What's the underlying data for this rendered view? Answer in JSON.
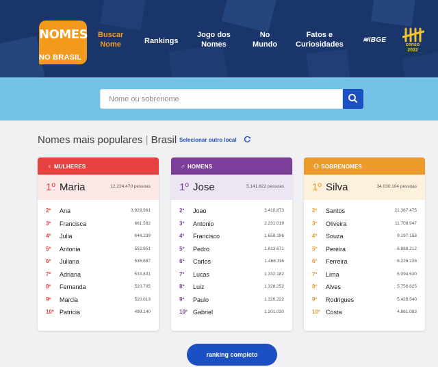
{
  "header": {
    "logo": {
      "top": "NOMES",
      "bottom": "NO BRASIL"
    },
    "nav": [
      {
        "label": "Buscar\nNome",
        "active": true
      },
      {
        "label": "Rankings",
        "active": false
      },
      {
        "label": "Jogo dos\nNomes",
        "active": false
      },
      {
        "label": "No\nMundo",
        "active": false
      },
      {
        "label": "Fatos e\nCuriosidades",
        "active": false
      }
    ],
    "ibge": "≋IBGE",
    "censo": "censo\n2022"
  },
  "search": {
    "placeholder": "Nome ou sobrenome",
    "value": ""
  },
  "main": {
    "heading_prefix": "Nomes mais populares",
    "heading_separator": "|",
    "heading_location": "Brasil",
    "select_location": "Selecionar outro local",
    "cta": "ranking completo"
  },
  "cards": [
    {
      "title": "MULHERES",
      "icon": "female-icon",
      "glyph": "♀",
      "head_color": "#e5423f",
      "top_bg": "#fde8e8",
      "rank_color": "#e5423f",
      "top": {
        "rank": "1º",
        "name": "Maria",
        "count": "12.224.470 pessoas"
      },
      "rows": [
        {
          "rank": "2º",
          "name": "Ana",
          "count": "3.929.961"
        },
        {
          "rank": "3º",
          "name": "Francisca",
          "count": "661.582"
        },
        {
          "rank": "4º",
          "name": "Julia",
          "count": "646.239"
        },
        {
          "rank": "5º",
          "name": "Antonia",
          "count": "552.951"
        },
        {
          "rank": "6º",
          "name": "Juliana",
          "count": "536.687"
        },
        {
          "rank": "7º",
          "name": "Adriana",
          "count": "533.801"
        },
        {
          "rank": "8º",
          "name": "Fernanda",
          "count": "520.705"
        },
        {
          "rank": "9º",
          "name": "Marcia",
          "count": "520.013"
        },
        {
          "rank": "10º",
          "name": "Patricia",
          "count": "499.140"
        }
      ]
    },
    {
      "title": "HOMENS",
      "icon": "male-icon",
      "glyph": "♂",
      "head_color": "#7b3f9a",
      "top_bg": "#eee5f3",
      "rank_color": "#7b3f9a",
      "top": {
        "rank": "1º",
        "name": "Jose",
        "count": "5.141.822 pessoas"
      },
      "rows": [
        {
          "rank": "2º",
          "name": "Joao",
          "count": "3.410.873"
        },
        {
          "rank": "3º",
          "name": "Antonio",
          "count": "2.231.019"
        },
        {
          "rank": "4º",
          "name": "Francisco",
          "count": "1.659.196"
        },
        {
          "rank": "5º",
          "name": "Pedro",
          "count": "1.613.671"
        },
        {
          "rank": "6º",
          "name": "Carlos",
          "count": "1.468.116"
        },
        {
          "rank": "7º",
          "name": "Lucas",
          "count": "1.332.182"
        },
        {
          "rank": "8º",
          "name": "Luiz",
          "count": "1.328.252"
        },
        {
          "rank": "9º",
          "name": "Paulo",
          "count": "1.326.222"
        },
        {
          "rank": "10º",
          "name": "Gabriel",
          "count": "1.201.030"
        }
      ]
    },
    {
      "title": "SOBRENOMES",
      "icon": "family-icon",
      "glyph": "⚇",
      "head_color": "#ec9a2a",
      "top_bg": "#fdf0dc",
      "rank_color": "#ec9a2a",
      "top": {
        "rank": "1º",
        "name": "Silva",
        "count": "34.030.104 pessoas"
      },
      "rows": [
        {
          "rank": "2º",
          "name": "Santos",
          "count": "21.367.475"
        },
        {
          "rank": "3º",
          "name": "Oliveira",
          "count": "11.708.947"
        },
        {
          "rank": "4º",
          "name": "Souza",
          "count": "9.197.158"
        },
        {
          "rank": "5º",
          "name": "Pereira",
          "count": "6.888.212"
        },
        {
          "rank": "6º",
          "name": "Ferreira",
          "count": "6.226.228"
        },
        {
          "rank": "7º",
          "name": "Lima",
          "count": "6.094.630"
        },
        {
          "rank": "8º",
          "name": "Alves",
          "count": "5.756.825"
        },
        {
          "rank": "9º",
          "name": "Rodrigues",
          "count": "5.428.540"
        },
        {
          "rank": "10º",
          "name": "Costa",
          "count": "4.861.083"
        }
      ]
    }
  ]
}
